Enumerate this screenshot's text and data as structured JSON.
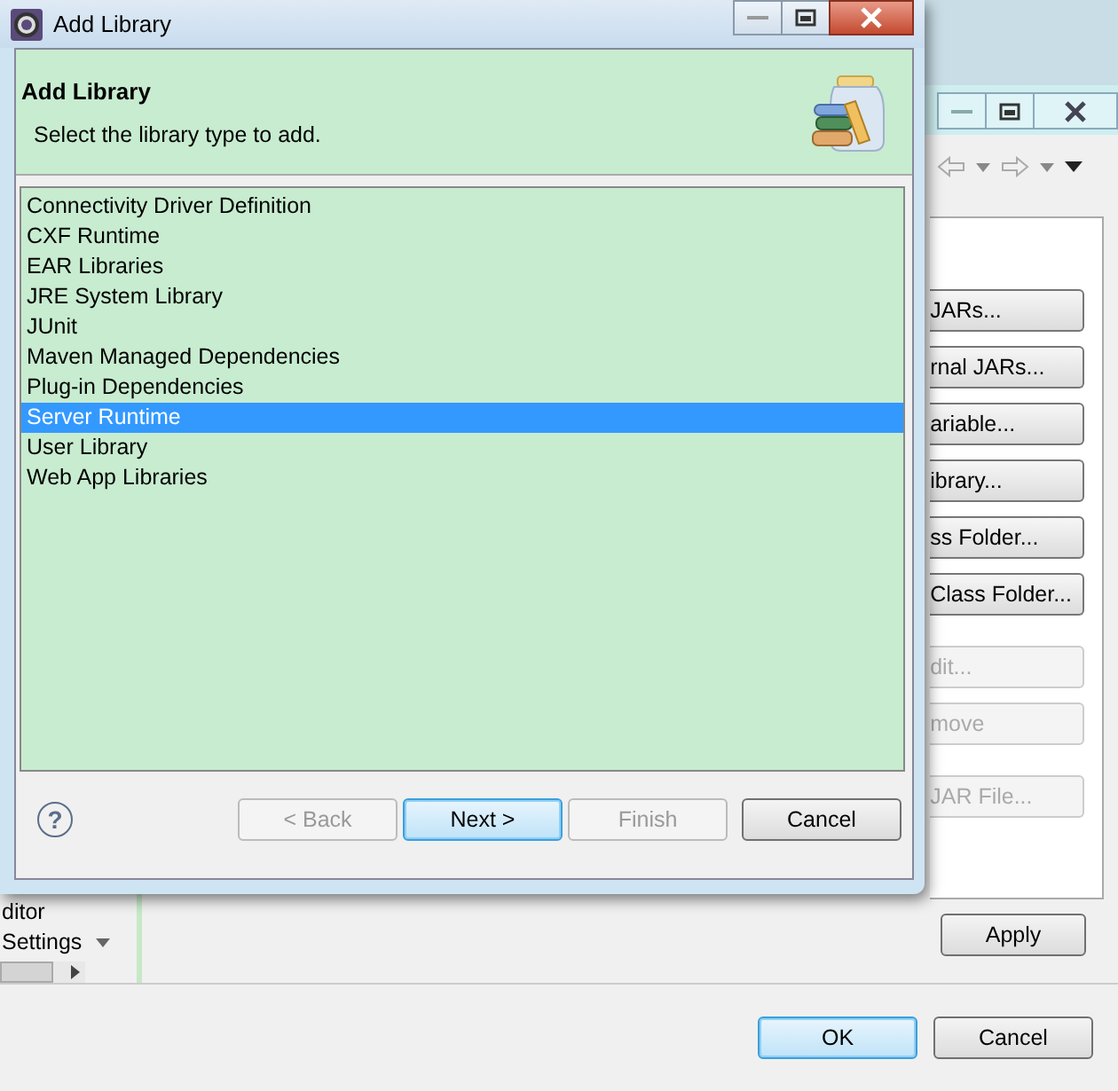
{
  "background_window": {
    "side_buttons": [
      {
        "label": "JARs...",
        "disabled": false
      },
      {
        "label": "rnal JARs...",
        "disabled": false
      },
      {
        "label": "ariable...",
        "disabled": false
      },
      {
        "label": "ibrary...",
        "disabled": false
      },
      {
        "label": "ss Folder...",
        "disabled": false
      },
      {
        "label": "Class Folder...",
        "disabled": false
      },
      {
        "label": "dit...",
        "disabled": true
      },
      {
        "label": "move",
        "disabled": true
      },
      {
        "label": "JAR File...",
        "disabled": true
      }
    ],
    "left_items": [
      "ditor",
      "Settings"
    ],
    "apply_button": "Apply",
    "footer_buttons": [
      {
        "label": "OK",
        "default": true
      },
      {
        "label": "Cancel",
        "default": false
      }
    ]
  },
  "dialog": {
    "title": "Add Library",
    "header_title": "Add Library",
    "header_message": "Select the library type to add.",
    "library_types": [
      {
        "label": "Connectivity Driver Definition",
        "selected": false
      },
      {
        "label": "CXF Runtime",
        "selected": false
      },
      {
        "label": "EAR Libraries",
        "selected": false
      },
      {
        "label": "JRE System Library",
        "selected": false
      },
      {
        "label": "JUnit",
        "selected": false
      },
      {
        "label": "Maven Managed Dependencies",
        "selected": false
      },
      {
        "label": "Plug-in Dependencies",
        "selected": false
      },
      {
        "label": "Server Runtime",
        "selected": true
      },
      {
        "label": "User Library",
        "selected": false
      },
      {
        "label": "Web App Libraries",
        "selected": false
      }
    ],
    "help_glyph": "?",
    "buttons": [
      {
        "label": "< Back",
        "disabled": true,
        "default": false
      },
      {
        "label": "Next >",
        "disabled": false,
        "default": true
      },
      {
        "label": "Finish",
        "disabled": true,
        "default": false
      },
      {
        "label": "Cancel",
        "disabled": false,
        "default": false
      }
    ]
  }
}
